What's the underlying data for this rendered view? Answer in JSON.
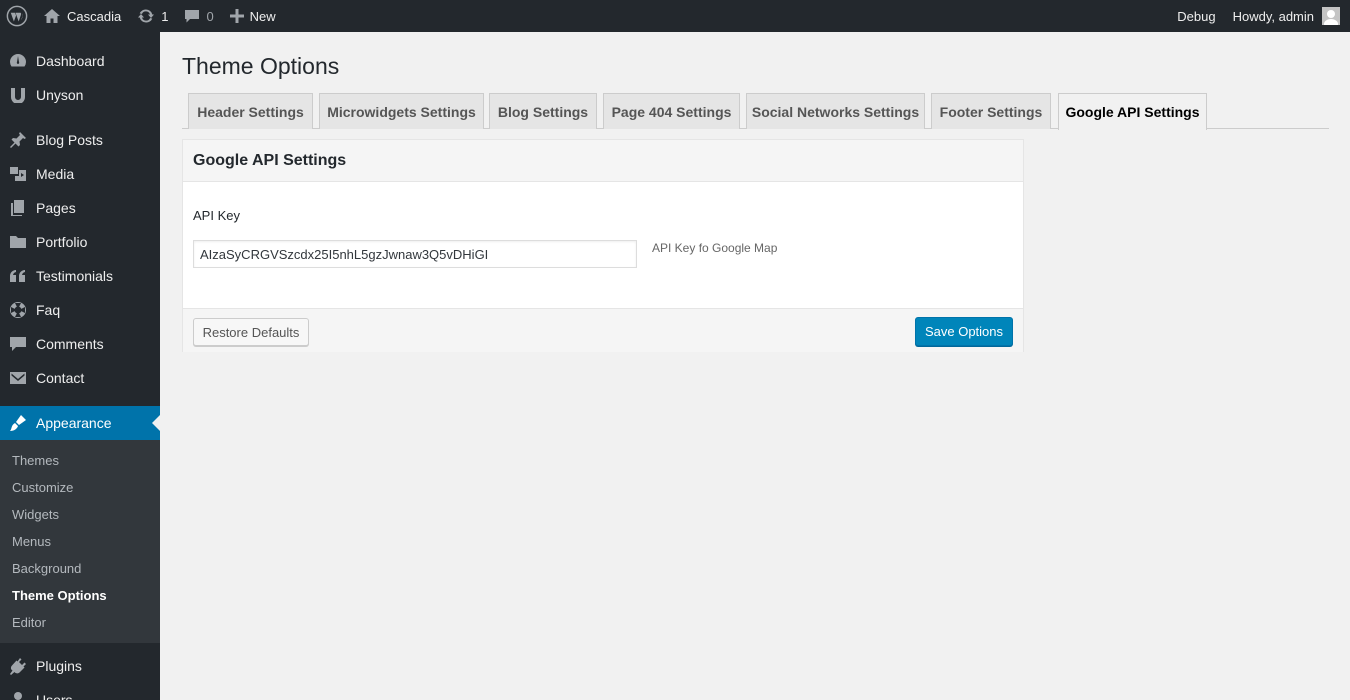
{
  "adminbar": {
    "site_name": "Cascadia",
    "updates_count": "1",
    "comments_count": "0",
    "new_label": "New",
    "debug_label": "Debug",
    "howdy_label": "Howdy, admin"
  },
  "sidebar": {
    "items": [
      {
        "label": "Dashboard",
        "icon": "dashboard-icon"
      },
      {
        "label": "Unyson",
        "icon": "unyson-icon"
      },
      {
        "label": "Blog Posts",
        "icon": "pin-icon"
      },
      {
        "label": "Media",
        "icon": "media-icon"
      },
      {
        "label": "Pages",
        "icon": "pages-icon"
      },
      {
        "label": "Portfolio",
        "icon": "folder-icon"
      },
      {
        "label": "Testimonials",
        "icon": "quote-icon"
      },
      {
        "label": "Faq",
        "icon": "lifebuoy-icon"
      },
      {
        "label": "Comments",
        "icon": "comment-icon"
      },
      {
        "label": "Contact",
        "icon": "mail-icon"
      },
      {
        "label": "Appearance",
        "icon": "brush-icon"
      },
      {
        "label": "Plugins",
        "icon": "plugin-icon"
      },
      {
        "label": "Users",
        "icon": "user-icon"
      }
    ],
    "submenu": [
      "Themes",
      "Customize",
      "Widgets",
      "Menus",
      "Background",
      "Theme Options",
      "Editor"
    ]
  },
  "main": {
    "title": "Theme Options",
    "tabs": [
      "Header Settings",
      "Microwidgets Settings",
      "Blog Settings",
      "Page 404 Settings",
      "Social Networks Settings",
      "Footer Settings",
      "Google API Settings"
    ],
    "active_tab": "Google API Settings",
    "panel": {
      "title": "Google API Settings",
      "field_label": "API Key",
      "field_value": "AIzaSyCRGVSzcdx25I5nhL5gzJwnaw3Q5vDHiGI",
      "field_desc": "API Key fo Google Map",
      "restore_label": "Restore Defaults",
      "save_label": "Save Options"
    }
  },
  "colors": {
    "accent": "#0073aa",
    "admin_dark": "#23282d",
    "submenu_bg": "#32373c",
    "button_primary": "#0085ba"
  }
}
